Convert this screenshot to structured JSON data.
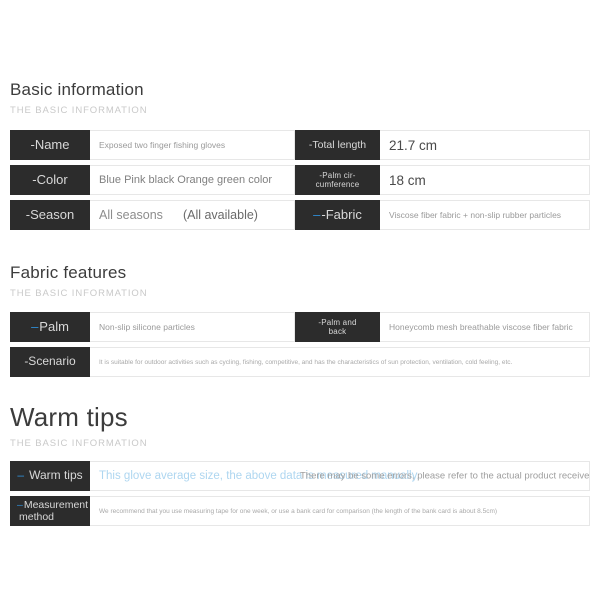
{
  "sections": [
    {
      "id": "basic-information",
      "title": "Basic information",
      "subtitle": "THE BASIC INFORMATION",
      "rows": [
        {
          "left": {
            "label": "-Name",
            "value": "Exposed two finger fishing gloves"
          },
          "right": {
            "label": "-Total length",
            "value": "21.7 cm"
          }
        },
        {
          "left": {
            "label": "-Color",
            "value": "Blue Pink black Orange green color"
          },
          "right": {
            "label": "-Palm cir-cumference",
            "label_line1": "-Palm cir-",
            "label_line2": "cumference",
            "value": "18 cm"
          }
        },
        {
          "left": {
            "label": "-Season",
            "value_part1": "All seasons",
            "value_part2": "(All available)"
          },
          "right": {
            "label": "-Fabric",
            "dash": "–",
            "value": "Viscose fiber fabric + non-slip rubber particles"
          }
        }
      ]
    },
    {
      "id": "fabric-features",
      "title": "Fabric features",
      "subtitle": "THE BASIC INFORMATION",
      "rows": [
        {
          "left": {
            "label": "Palm",
            "dash": "–",
            "value": "Non-slip silicone particles"
          },
          "right": {
            "label": "-Palm and back",
            "label_line1": "-Palm and",
            "label_line2": "back",
            "value": "Honeycomb mesh breathable viscose fiber fabric"
          }
        },
        {
          "full": {
            "label": "-Scenario",
            "value": "It is suitable for outdoor activities such as cycling, fishing, competitive, and has the characteristics of sun protection, ventilation, cold feeling, etc."
          }
        }
      ]
    },
    {
      "id": "warm-tips",
      "title": "Warm tips",
      "subtitle": "THE BASIC INFORMATION",
      "rows": [
        {
          "full": {
            "label": "Warm tips",
            "dash": "–",
            "value_overlay_a": "This glove average size, the above data is measured manually,",
            "value_overlay_b": "There may be some errors, please refer to the actual product received! Thank you"
          }
        },
        {
          "full": {
            "label": "Measurement method",
            "label_line1": "Measurement",
            "label_line2": "method",
            "dash": "–",
            "value": "We recommend that you use measuring tape for one week, or use a bank card for comparison (the length of the bank card is about 8.5cm)"
          }
        }
      ]
    }
  ],
  "colors": {
    "label_background": "#2c2c2c",
    "label_text": "#d8d8d8",
    "accent_dash": "#2f8fd8",
    "highlight_text": "#aed6f0",
    "page_background": "#ffffff",
    "border": "#e7e7e7"
  }
}
